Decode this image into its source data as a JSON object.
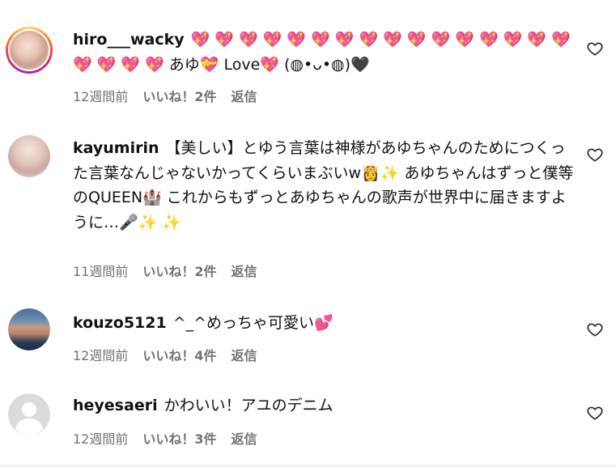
{
  "comments": [
    {
      "username": "hiro___wacky",
      "text": "💖 💖 💖 💖 💖 💖 💖 💖 💖 💖 💖 💖 💖 💖 💖 💖 💖 💖 💖 💖 あゆ💝 Love💖 (◍•ᴗ•◍)🖤",
      "time": "12週間前",
      "likes": "いいね！2件",
      "reply": "返信",
      "avatar_icon": "profile-photo-icon",
      "has_story_ring": true
    },
    {
      "username": "kayumirin",
      "text": "【美しい】とゆう言葉は神様があゆちゃんのためにつくった言葉なんじゃないかってくらいまぶいw👸✨ あゆちゃんはずっと僕等のQUEEN🏰 これからもずっとあゆちゃんの歌声が世界中に届きますように…🎤✨ ✨",
      "time": "11週間前",
      "likes": "いいね！2件",
      "reply": "返信",
      "avatar_icon": "profile-photo-icon",
      "has_story_ring": false
    },
    {
      "username": "kouzo5121",
      "text": "^_^めっちゃ可愛い💕",
      "time": "12週間前",
      "likes": "いいね！4件",
      "reply": "返信",
      "avatar_icon": "profile-photo-icon",
      "has_story_ring": false
    },
    {
      "username": "heyesaeri",
      "text": "かわいい！アユのデニム",
      "time": "12週間前",
      "likes": "いいね！3件",
      "reply": "返信",
      "avatar_icon": "default-avatar-icon",
      "has_story_ring": false
    }
  ],
  "icons": {
    "like": "heart-outline-icon"
  },
  "colors": {
    "meta_text": "#737373",
    "story_ring": "#d62976"
  }
}
